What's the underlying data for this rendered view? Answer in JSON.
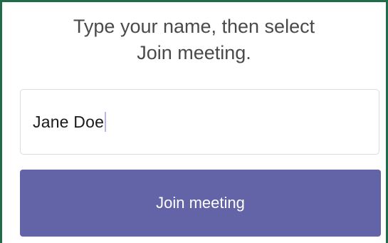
{
  "instructions": {
    "line1": "Type your name, then select",
    "line2": "Join meeting."
  },
  "name_input": {
    "value": "Jane Doe"
  },
  "join_button": {
    "label": "Join meeting"
  },
  "colors": {
    "frame_border": "#1f6b4a",
    "button_background": "#6264a7",
    "button_text": "#ffffff",
    "instruction_text": "#4a4a4a"
  }
}
